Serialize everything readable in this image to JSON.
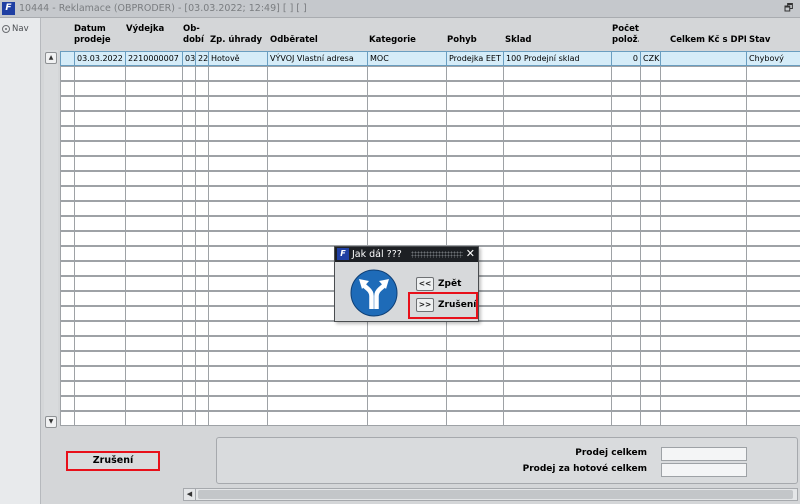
{
  "window": {
    "logo_text": "F",
    "title": "10444 - Reklamace (OBPRODER) - [03.03.2022; 12:49]  [ ] [ ]",
    "restore_glyph": "🗗"
  },
  "nav": {
    "label": "Nav"
  },
  "grid": {
    "headers": [
      {
        "line1": "Datum",
        "line2": "prodeje"
      },
      {
        "line1": "",
        "line2": "Výdejka"
      },
      {
        "line1": "Ob-",
        "line2": "dobí"
      },
      {
        "line1": "",
        "line2": ""
      },
      {
        "line1": "",
        "line2": "Zp. úhrady"
      },
      {
        "line1": "",
        "line2": "Odběratel"
      },
      {
        "line1": "",
        "line2": "Kategorie"
      },
      {
        "line1": "",
        "line2": "Pohyb"
      },
      {
        "line1": "",
        "line2": "Sklad"
      },
      {
        "line1": "Počet",
        "line2": "polož."
      },
      {
        "line1": "",
        "line2": ""
      },
      {
        "line1": "",
        "line2": "Celkem Kč s DPH"
      },
      {
        "line1": "",
        "line2": "Stav"
      }
    ],
    "rows": [
      [
        "03.03.2022",
        "2210000007",
        "03",
        "22",
        "Hotově",
        "VÝVOJ Vlastní adresa",
        "MOC",
        "Prodejka EET",
        "100 Prodejní sklad",
        "0",
        "CZK",
        "",
        "Chybový"
      ]
    ],
    "empty_row_count": 24,
    "scroll_up_glyph": "▲",
    "scroll_down_glyph": "▼"
  },
  "dialog": {
    "logo_text": "F",
    "title": "Jak dál ???",
    "close_glyph": "✕",
    "back_button": {
      "glyph": "<<",
      "label": "Zpět"
    },
    "forward_button": {
      "glyph": ">>",
      "label": "Zrušení"
    }
  },
  "footer": {
    "cancel_label": "Zrušení",
    "totals": {
      "prodej_celkem_label": "Prodej celkem",
      "prodej_celkem_value": "",
      "prodej_hotove_label": "Prodej za hotové celkem",
      "prodej_hotove_value": ""
    },
    "hscroll_left_glyph": "◀"
  },
  "colors": {
    "highlight_red": "#e8101a",
    "selected_row": "#d5ecf8",
    "logo_blue": "#1f3fa3",
    "sign_blue": "#1e6bb8"
  }
}
